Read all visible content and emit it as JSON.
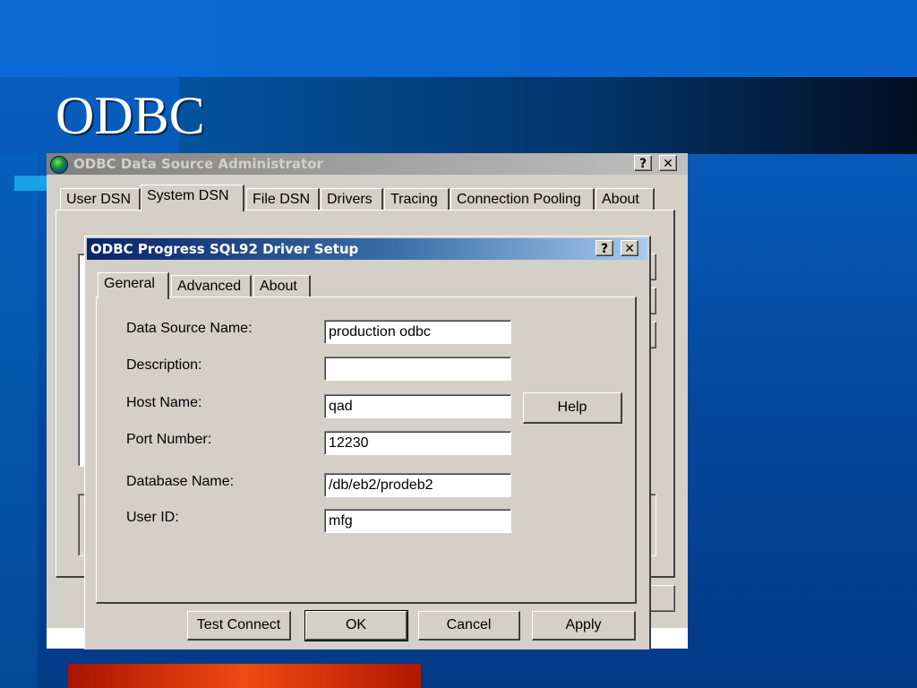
{
  "slide": {
    "title": "ODBC"
  },
  "admin_window": {
    "title": "ODBC Data Source Administrator",
    "help_glyph": "?",
    "close_glyph": "✕",
    "tabs": [
      {
        "label": "User DSN",
        "active": false
      },
      {
        "label": "System DSN",
        "active": true
      },
      {
        "label": "File DSN",
        "active": false
      },
      {
        "label": "Drivers",
        "active": false
      },
      {
        "label": "Tracing",
        "active": false
      },
      {
        "label": "Connection Pooling",
        "active": false
      },
      {
        "label": "About",
        "active": false
      }
    ],
    "icon": "odbc-globe-icon"
  },
  "setup_dialog": {
    "title": "ODBC Progress SQL92 Driver Setup",
    "help_glyph": "?",
    "close_glyph": "✕",
    "tabs": [
      {
        "label": "General",
        "active": true
      },
      {
        "label": "Advanced",
        "active": false
      },
      {
        "label": "About",
        "active": false
      }
    ],
    "fields": [
      {
        "label": "Data Source Name:",
        "value": "production odbc"
      },
      {
        "label": "Description:",
        "value": ""
      },
      {
        "label": "Host Name:",
        "value": "qad"
      },
      {
        "label": "Port Number:",
        "value": "12230"
      },
      {
        "label": "Database Name:",
        "value": "/db/eb2/prodeb2"
      },
      {
        "label": "User ID:",
        "value": "mfg"
      }
    ],
    "help_button": "Help",
    "buttons": {
      "test_connect": "Test Connect",
      "ok": "OK",
      "cancel": "Cancel",
      "apply": "Apply"
    }
  },
  "colors": {
    "slide_background": "#0656b4",
    "accent_bar": "#f04a12",
    "cyan_bar": "#1aa0e8",
    "active_titlebar": "#0a246a",
    "inactive_titlebar": "#808080",
    "window_face": "#d4d0c8"
  }
}
